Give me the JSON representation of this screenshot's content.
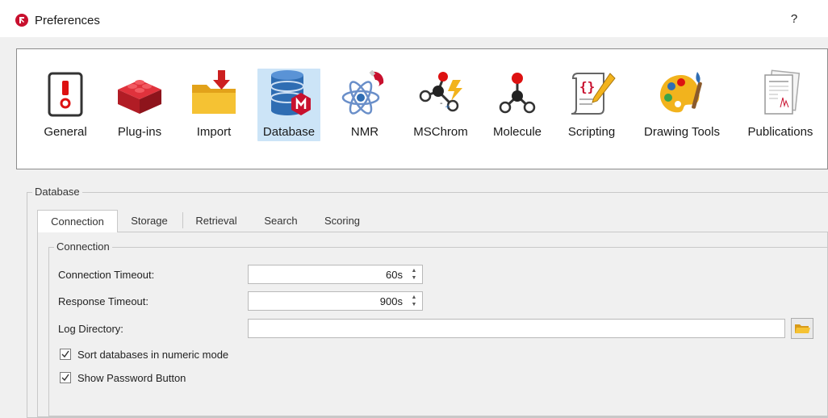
{
  "window": {
    "title": "Preferences",
    "help_label": "?"
  },
  "toolbar": {
    "selected": "Database",
    "items": [
      {
        "label": "General",
        "icon": "general-switch-icon"
      },
      {
        "label": "Plug-ins",
        "icon": "plugins-brick-icon"
      },
      {
        "label": "Import",
        "icon": "import-folder-icon"
      },
      {
        "label": "Database",
        "icon": "database-icon"
      },
      {
        "label": "NMR",
        "icon": "nmr-atom-magnet-icon"
      },
      {
        "label": "MSChrom",
        "icon": "mschrom-molecule-icon"
      },
      {
        "label": "Molecule",
        "icon": "molecule-icon"
      },
      {
        "label": "Scripting",
        "icon": "scripting-icon"
      },
      {
        "label": "Drawing Tools",
        "icon": "palette-icon"
      },
      {
        "label": "Publications",
        "icon": "publications-icon"
      }
    ]
  },
  "database_group": {
    "title": "Database",
    "tabs": [
      {
        "label": "Connection",
        "active": true
      },
      {
        "label": "Storage",
        "active": false
      },
      {
        "label": "Retrieval",
        "active": false
      },
      {
        "label": "Search",
        "active": false
      },
      {
        "label": "Scoring",
        "active": false
      }
    ],
    "connection_group": {
      "title": "Connection",
      "connection_timeout": {
        "label": "Connection Timeout:",
        "value": "60s"
      },
      "response_timeout": {
        "label": "Response Timeout:",
        "value": "900s"
      },
      "log_directory": {
        "label": "Log Directory:",
        "value": ""
      },
      "sort_numeric": {
        "label": "Sort databases in numeric mode",
        "checked": true
      },
      "show_password": {
        "label": "Show Password Button",
        "checked": true
      }
    }
  }
}
